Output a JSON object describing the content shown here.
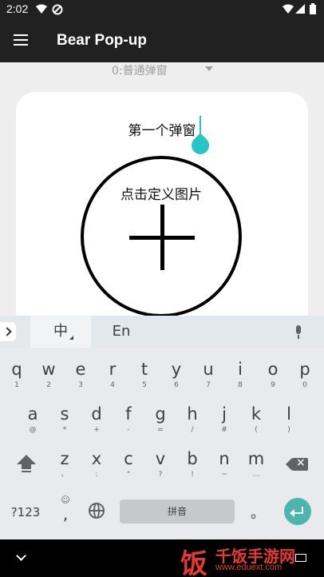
{
  "status_bar": {
    "time": "2:02"
  },
  "app_bar": {
    "title": "Bear Pop-up"
  },
  "spinner": {
    "selected": "0:普通弹窗"
  },
  "popup": {
    "title": "第一个弹窗",
    "image_label": "点击定义图片"
  },
  "keyboard": {
    "lang_zh": "中",
    "lang_en": "En",
    "row1": [
      {
        "key": "q",
        "hint": "1"
      },
      {
        "key": "w",
        "hint": "2"
      },
      {
        "key": "e",
        "hint": "3"
      },
      {
        "key": "r",
        "hint": "4"
      },
      {
        "key": "t",
        "hint": "5"
      },
      {
        "key": "y",
        "hint": "6"
      },
      {
        "key": "u",
        "hint": "7"
      },
      {
        "key": "i",
        "hint": "8"
      },
      {
        "key": "o",
        "hint": "9"
      },
      {
        "key": "p",
        "hint": "0"
      }
    ],
    "row2": [
      {
        "key": "a",
        "hint": "@"
      },
      {
        "key": "s",
        "hint": "*"
      },
      {
        "key": "d",
        "hint": "+"
      },
      {
        "key": "f",
        "hint": "-"
      },
      {
        "key": "g",
        "hint": "="
      },
      {
        "key": "h",
        "hint": "/"
      },
      {
        "key": "j",
        "hint": "#"
      },
      {
        "key": "k",
        "hint": "("
      },
      {
        "key": "l",
        "hint": ")"
      }
    ],
    "row3": [
      {
        "key": "z",
        "hint": "、"
      },
      {
        "key": "x",
        "hint": ":"
      },
      {
        "key": "c",
        "hint": "\""
      },
      {
        "key": "v",
        "hint": "?"
      },
      {
        "key": "b",
        "hint": "!"
      },
      {
        "key": "n",
        "hint": "~"
      },
      {
        "key": "m",
        "hint": "…"
      }
    ],
    "symbols_key": "?123",
    "comma_key": ",",
    "comma_hint": "☺",
    "space_label": "拼音",
    "period_key": "。"
  },
  "watermark": {
    "brand": "千饭手游网",
    "url": "www.eduext.com",
    "glyph": "饭"
  }
}
